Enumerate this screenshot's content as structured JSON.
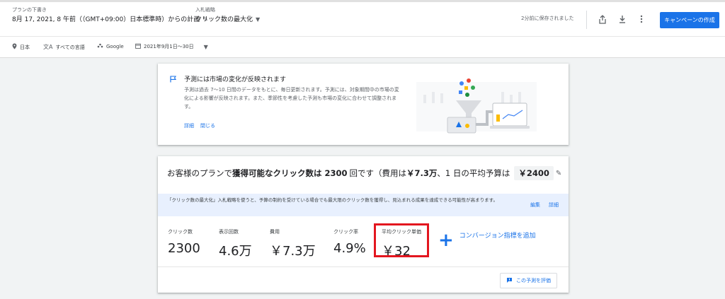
{
  "header": {
    "plan_label": "プランの下書き",
    "plan_value": "8月 17, 2021, 8 午前（（GMT+09:00）日本標準時）からの計画",
    "bid_label": "入札戦略",
    "bid_value": "クリック数の最大化",
    "saved_text": "2分前に保存されました",
    "create_button": "キャンペーンの作成"
  },
  "filters": [
    {
      "icon": "location-icon",
      "label": "日本"
    },
    {
      "icon": "language-icon",
      "label": "すべての言語"
    },
    {
      "icon": "network-icon",
      "label": "Google"
    },
    {
      "icon": "calendar-icon",
      "label": "2021年9月1日～30日"
    }
  ],
  "notice": {
    "title": "予測には市場の変化が反映されます",
    "body": "予測は過去 7～10 日間のデータをもとに、毎日更新されます。予測には、対象期間中の市場の変化による影響が反映されます。また、季節性を考慮した予測も市場の変化に合わせて調整されます。",
    "link_details": "詳細",
    "link_close": "閉じる"
  },
  "summary": {
    "headline_pre": "お客様のプランで",
    "headline_bold1": "獲得可能なクリック数は",
    "clicks": "2300",
    "headline_mid": "回です（費用は",
    "cost": "￥7.3万",
    "headline_mid2": "、1 日の平均予算は",
    "budget": "￥2400",
    "banner_text": "「クリック数の最大化」入札戦略を使うと、予算の制約を受けている場合でも最大限のクリック数を獲得し、見込まれる成果を達成できる可能性が高まります。",
    "banner_edit": "編集",
    "banner_details": "詳細",
    "metrics": [
      {
        "label": "クリック数",
        "value": "2300"
      },
      {
        "label": "表示回数",
        "value": "4.6万"
      },
      {
        "label": "費用",
        "value": "￥7.3万"
      },
      {
        "label": "クリック率",
        "value": "4.9%"
      },
      {
        "label": "平均クリック単価",
        "value": "￥32"
      }
    ],
    "conversion_add": "コンバージョン指標を追加",
    "rate_button": "この予測を評価"
  },
  "colors": {
    "accent": "#1a73e8",
    "highlight": "#e3161f"
  }
}
